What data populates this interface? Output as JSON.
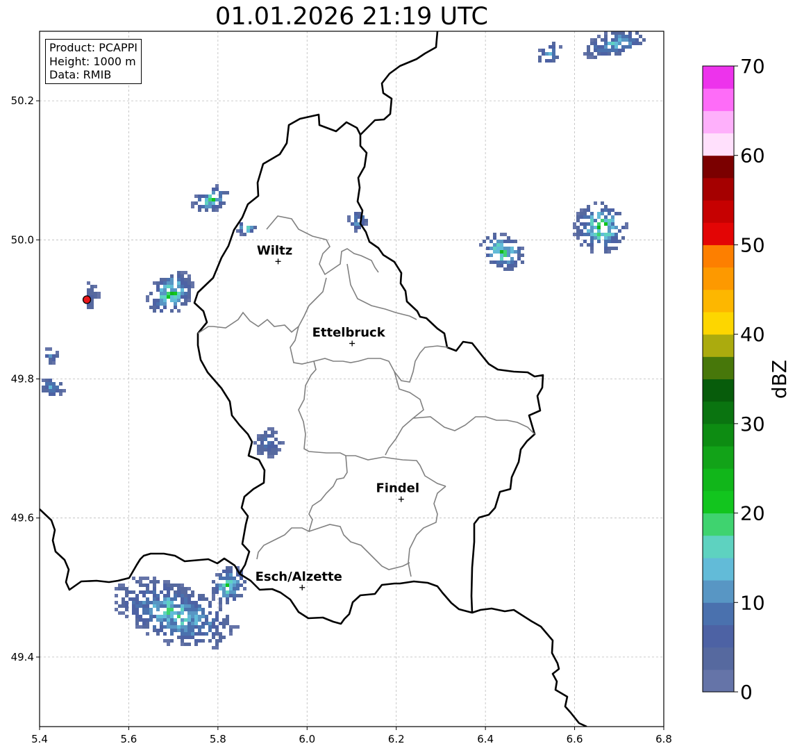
{
  "title": "01.01.2026 21:19 UTC",
  "info_box": [
    "Product: PCAPPI",
    "Height: 1000 m",
    "Data: RMIB"
  ],
  "axes": {
    "x_range": [
      5.4,
      6.8
    ],
    "y_range": [
      49.3,
      50.3
    ],
    "x_ticks": [
      5.4,
      5.6,
      5.8,
      6.0,
      6.2,
      6.4,
      6.6,
      6.8
    ],
    "x_tick_labels": [
      "5.4",
      "5.6",
      "5.8",
      "6.0",
      "6.2",
      "6.4",
      "6.6",
      "6.8"
    ],
    "y_ticks": [
      49.4,
      49.6,
      49.8,
      50.0,
      50.2
    ],
    "y_tick_labels": [
      "49.4",
      "49.6",
      "49.8",
      "50.0",
      "50.2"
    ],
    "grid": true
  },
  "cities": [
    {
      "name": "Wiltz",
      "lon": 5.935,
      "lat": 49.969
    },
    {
      "name": "Ettelbruck",
      "lon": 6.101,
      "lat": 49.851
    },
    {
      "name": "Findel",
      "lon": 6.211,
      "lat": 49.627
    },
    {
      "name": "Esch/Alzette",
      "lon": 5.989,
      "lat": 49.5
    }
  ],
  "radar_site": {
    "lon": 5.506,
    "lat": 49.914,
    "color": "#e8161a"
  },
  "colorbar": {
    "label": "dBZ",
    "min": 0,
    "max": 70,
    "tick_values": [
      0,
      10,
      20,
      30,
      40,
      50,
      60,
      70
    ],
    "tick_labels": [
      "0",
      "10",
      "20",
      "30",
      "40",
      "50",
      "60",
      "70"
    ],
    "colors": [
      "#6574a8",
      "#56699f",
      "#4d62a4",
      "#4a71ae",
      "#5896c4",
      "#62bbd8",
      "#5ed2c0",
      "#3fd36f",
      "#12c51e",
      "#11b61a",
      "#12a318",
      "#0d8c12",
      "#0a7410",
      "#075c0b",
      "#47770a",
      "#abab0e",
      "#fdd600",
      "#fdb700",
      "#fd9900",
      "#fd7f00",
      "#e30505",
      "#c60101",
      "#a50000",
      "#7b0000",
      "#ffe0fc",
      "#feb0fb",
      "#fe6cf8",
      "#ed33ec"
    ]
  },
  "echo_cells": [
    {
      "name": "echo-west-belgium",
      "lon": 5.69,
      "lat": 49.925,
      "len": 0.12,
      "width": 0.028,
      "angle": -42,
      "peak_dbz": 22
    },
    {
      "name": "echo-wiltz-north",
      "lon": 5.78,
      "lat": 50.06,
      "len": 0.09,
      "width": 0.018,
      "angle": -25,
      "peak_dbz": 20
    },
    {
      "name": "echo-wiltz-northeast",
      "lon": 5.86,
      "lat": 50.02,
      "len": 0.04,
      "width": 0.014,
      "angle": -60,
      "peak_dbz": 20
    },
    {
      "name": "echo-radar-site",
      "lon": 5.51,
      "lat": 49.92,
      "len": 0.04,
      "width": 0.025,
      "angle": 0,
      "peak_dbz": 8
    },
    {
      "name": "echo-west-edge-north",
      "lon": 5.42,
      "lat": 49.835,
      "len": 0.04,
      "width": 0.012,
      "angle": -50,
      "peak_dbz": 10
    },
    {
      "name": "echo-west-edge-south",
      "lon": 5.425,
      "lat": 49.79,
      "len": 0.045,
      "width": 0.018,
      "angle": -70,
      "peak_dbz": 15
    },
    {
      "name": "echo-middle",
      "lon": 5.91,
      "lat": 49.71,
      "len": 0.07,
      "width": 0.022,
      "angle": -45,
      "peak_dbz": 10
    },
    {
      "name": "echo-sauer",
      "lon": 6.11,
      "lat": 50.03,
      "len": 0.05,
      "width": 0.014,
      "angle": -70,
      "peak_dbz": 15
    },
    {
      "name": "echo-east-1",
      "lon": 6.435,
      "lat": 49.985,
      "len": 0.08,
      "width": 0.035,
      "angle": -62,
      "peak_dbz": 22
    },
    {
      "name": "echo-east-2",
      "lon": 6.655,
      "lat": 50.02,
      "len": 0.12,
      "width": 0.04,
      "angle": -58,
      "peak_dbz": 22
    },
    {
      "name": "echo-northeast",
      "lon": 6.69,
      "lat": 50.285,
      "len": 0.16,
      "width": 0.02,
      "angle": -15,
      "peak_dbz": 16
    },
    {
      "name": "echo-north-center",
      "lon": 6.54,
      "lat": 50.27,
      "len": 0.06,
      "width": 0.015,
      "angle": -45,
      "peak_dbz": 16
    },
    {
      "name": "echo-south-band",
      "lon": 5.7,
      "lat": 49.465,
      "len": 0.3,
      "width": 0.045,
      "angle": 20,
      "peak_dbz": 18
    },
    {
      "name": "echo-south-band-east",
      "lon": 5.82,
      "lat": 49.505,
      "len": 0.08,
      "width": 0.03,
      "angle": 25,
      "peak_dbz": 20
    }
  ]
}
